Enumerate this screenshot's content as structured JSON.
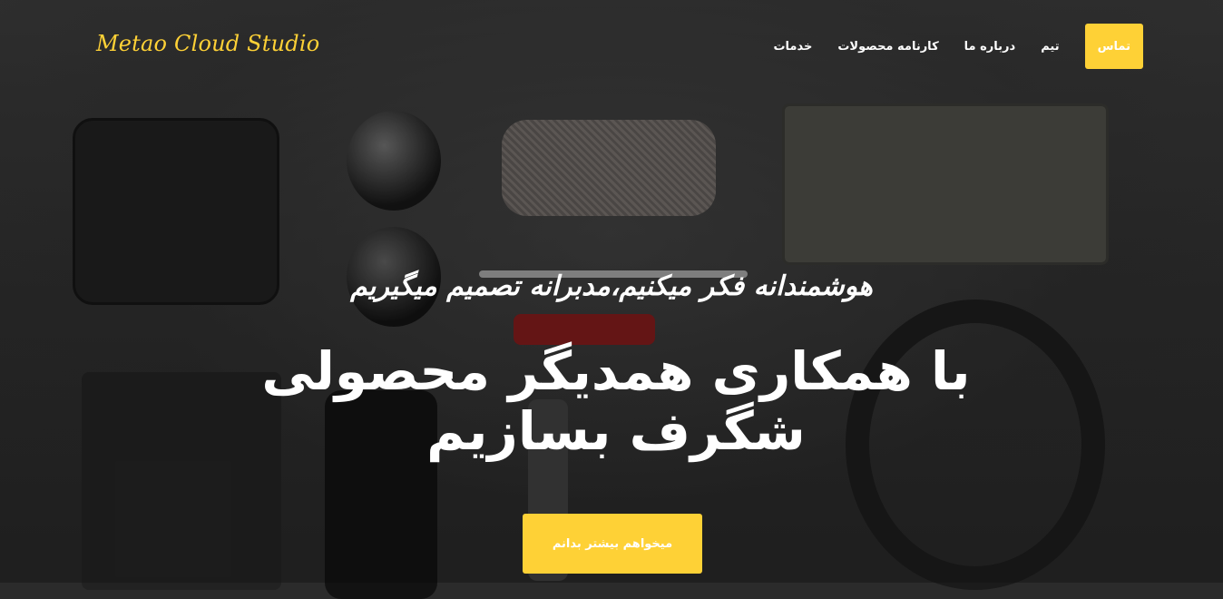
{
  "brand": {
    "name": "Metao Cloud Studio"
  },
  "nav": {
    "items": [
      {
        "id": "contact",
        "label": "تماس"
      },
      {
        "id": "team",
        "label": "تیم"
      },
      {
        "id": "about",
        "label": "درباره ما"
      },
      {
        "id": "portfolio",
        "label": "کارنامه محصولات"
      },
      {
        "id": "services",
        "label": "خدمات"
      }
    ]
  },
  "hero": {
    "lead": "هوشمندانه فکر میکنیم،مدبرانه تصمیم میگیریم",
    "heading": "با همکاری همدیگر محصولی شگرف بسازیم",
    "cta_label": "میخواهم بیشتر بدانم"
  },
  "colors": {
    "accent": "#fed136",
    "text": "#ffffff"
  }
}
